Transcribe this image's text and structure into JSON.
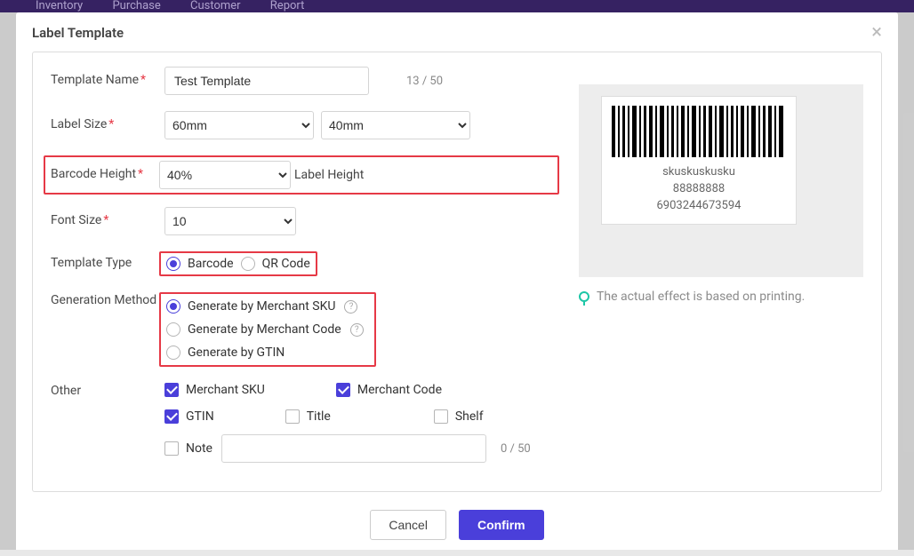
{
  "nav": {
    "inventory": "Inventory",
    "purchase": "Purchase",
    "customer": "Customer",
    "report": "Report"
  },
  "modal": {
    "title": "Label Template"
  },
  "fields": {
    "templateName": {
      "label": "Template Name",
      "value": "Test Template",
      "counter": "13 / 50"
    },
    "labelSize": {
      "label": "Label Size",
      "width": "60mm",
      "height": "40mm"
    },
    "barcodeHeight": {
      "label": "Barcode Height",
      "value": "40%",
      "suffix": "Label Height"
    },
    "fontSize": {
      "label": "Font Size",
      "value": "10"
    },
    "templateType": {
      "label": "Template Type",
      "barcode": "Barcode",
      "qrcode": "QR Code"
    },
    "generation": {
      "label": "Generation Method",
      "bySku": "Generate by Merchant SKU",
      "byCode": "Generate by Merchant Code",
      "byGtin": "Generate by GTIN"
    },
    "other": {
      "label": "Other",
      "merchantSku": "Merchant SKU",
      "merchantCode": "Merchant Code",
      "gtin": "GTIN",
      "title": "Title",
      "shelf": "Shelf",
      "note": "Note",
      "noteCounter": "0 / 50"
    }
  },
  "preview": {
    "line1": "skuskuskusku",
    "line2": "88888888",
    "line3": "6903244673594",
    "hint": "The actual effect is based on printing."
  },
  "buttons": {
    "cancel": "Cancel",
    "confirm": "Confirm"
  }
}
